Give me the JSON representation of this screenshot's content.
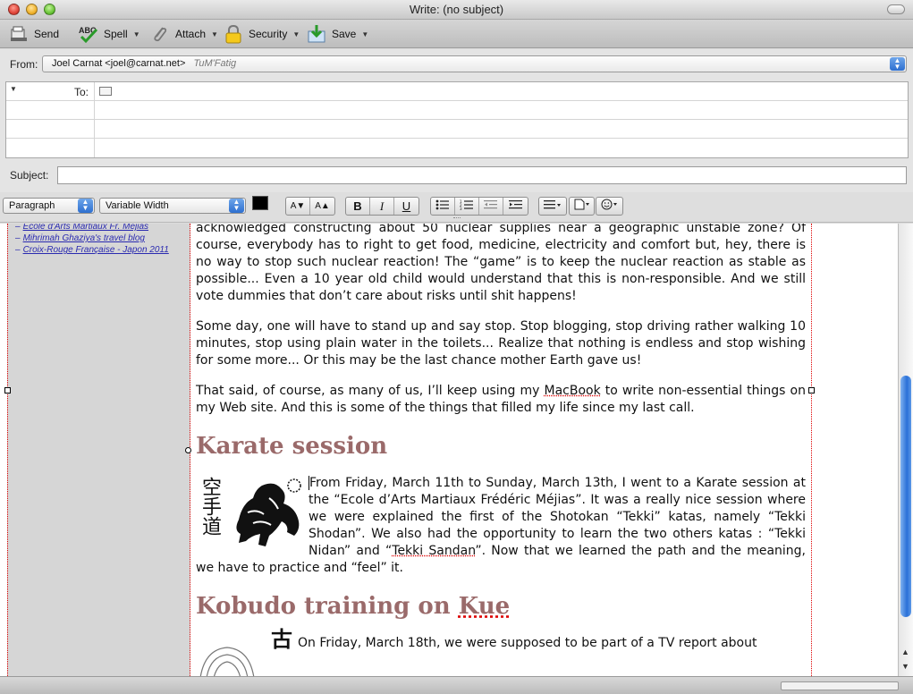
{
  "window": {
    "title": "Write: (no subject)"
  },
  "toolbar": {
    "send": "Send",
    "spell": "Spell",
    "attach": "Attach",
    "security": "Security",
    "save": "Save",
    "spell_icon_text": "ABC"
  },
  "header": {
    "from_label": "From:",
    "from_value": "Joel Carnat <joel@carnat.net>",
    "from_signature": "TuM'Fatig",
    "to_label": "To:",
    "subject_label": "Subject:",
    "subject_value": ""
  },
  "format": {
    "paragraph": "Paragraph",
    "font": "Variable Width",
    "bold": "B",
    "italic": "I",
    "underline": "U",
    "smaller_font": "A▼",
    "larger_font": "A▲"
  },
  "sidebar": {
    "links": [
      "Ecole d'Arts Martiaux Fr. Méjias",
      "Mihrimah Ghaziya's travel blog",
      "Croix-Rouge Française - Japon 2011"
    ]
  },
  "article": {
    "para1": "acknowledged constructing about 50 nuclear supplies near a geographic unstable zone? Of course, everybody has to right to get food, medicine, electricity and comfort but, hey, there is no way to stop such nuclear reaction! The “game” is to keep the nuclear reaction as stable as possible... Even a 10 year old child would understand that this is non-responsible. And we still vote dummies that don’t care about risks until shit happens!",
    "para2": "Some day, one will have to stand up and say stop. Stop blogging, stop driving rather walking 10 minutes, stop using plain water in the toilets... Realize that nothing is endless and stop wishing for some more... Or this may be the last chance mother Earth gave us!",
    "para3_a": "That said, of course, as many of us, I’ll keep using my ",
    "para3_macbook": "MacBook",
    "para3_b": " to write non-essential things on my Web site. And this is some of the things that filled my life since my last call.",
    "h_karate": "Karate session",
    "karate_kanji": "空手道",
    "karate_a": "From Friday, March 11th to Sunday, March 13th, I went to a Karate session at the “Ecole d’Arts Martiaux Frédéric Méjias”. It was a really nice session where we were explained the first of the Shotokan “Tekki” katas, namely “Tekki Shodan”. We also had the opportunity to learn the two others katas : “Tekki Nidan” and “",
    "karate_tekki": "Tekki Sandan",
    "karate_b": "”. Now that we learned the path and the meaning, we have to practice and “feel” it.",
    "h_kobudo_a": "Kobudo training on ",
    "h_kobudo_kue": "Kue",
    "kobudo_kanji": "古",
    "kobudo_text": "On Friday, March 18th, we were supposed to be part of a TV report about"
  },
  "colors": {
    "heading": "#9a6a6a",
    "link": "#2a2ab0",
    "accent": "#2d6fd0"
  }
}
